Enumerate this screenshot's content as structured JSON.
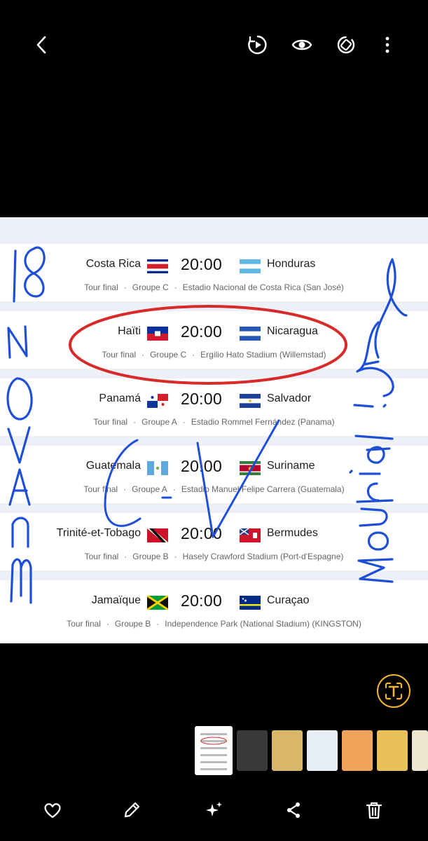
{
  "topbar": {
    "icons": [
      "back-icon",
      "motion-photo-icon",
      "eye-icon",
      "rotate-icon",
      "more-options-icon"
    ]
  },
  "matches": [
    {
      "home": "Costa Rica",
      "time": "20:00",
      "away": "Honduras",
      "round": "Tour final",
      "group": "Groupe C",
      "venue": "Estadio Nacional de Costa Rica (San José)"
    },
    {
      "home": "Haïti",
      "time": "20:00",
      "away": "Nicaragua",
      "round": "Tour final",
      "group": "Groupe C",
      "venue": "Ergilio Hato Stadium (Willemstad)"
    },
    {
      "home": "Panamá",
      "time": "20:00",
      "away": "Salvador",
      "round": "Tour final",
      "group": "Groupe A",
      "venue": "Estadio Rommel Fernández (Panama)"
    },
    {
      "home": "Guatemala",
      "time": "20:00",
      "away": "Suriname",
      "round": "Tour final",
      "group": "Groupe A",
      "venue": "Estadio Manuel Felipe Carrera (Guatemala)"
    },
    {
      "home": "Trinité-et-Tobago",
      "time": "20:00",
      "away": "Bermudes",
      "round": "Tour final",
      "group": "Groupe B",
      "venue": "Hasely Crawford Stadium (Port-d'Espagne)"
    },
    {
      "home": "Jamaïque",
      "time": "20:00",
      "away": "Curaçao",
      "round": "Tour final",
      "group": "Groupe B",
      "venue": "Independence Park (National Stadium) (KINGSTON)"
    }
  ],
  "meta_separator": "·",
  "handwriting": {
    "left": "18 NOVAnm",
    "middle": "C.V",
    "right": "Mondial life"
  },
  "colors": {
    "background": "#000000",
    "accent_lens": "#f2b531",
    "annotation_blue": "#1f4fd6",
    "annotation_red": "#d82a2a"
  },
  "bottombar": {
    "icons": [
      "heart-icon",
      "edit-icon",
      "sparkle-icon",
      "share-icon",
      "delete-icon"
    ]
  },
  "lens": {
    "icon": "text-extract-icon"
  }
}
